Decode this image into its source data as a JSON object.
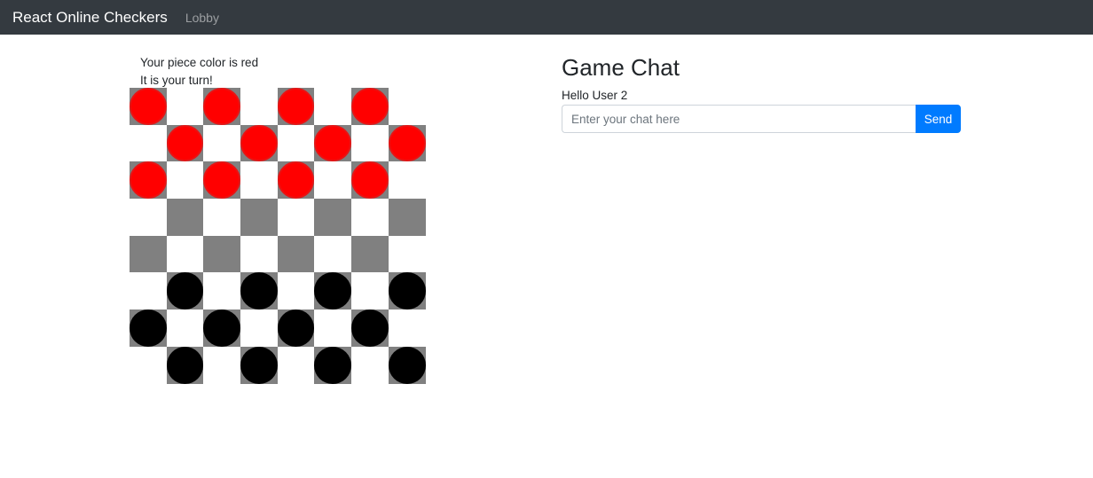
{
  "navbar": {
    "brand": "React Online Checkers",
    "links": [
      "Lobby"
    ]
  },
  "game": {
    "color_message": "Your piece color is red",
    "turn_message": "It is your turn!",
    "board": [
      [
        "r",
        ".",
        "r",
        ".",
        "r",
        ".",
        "r",
        "."
      ],
      [
        ".",
        "r",
        ".",
        "r",
        ".",
        "r",
        ".",
        "r"
      ],
      [
        "r",
        ".",
        "r",
        ".",
        "r",
        ".",
        "r",
        "."
      ],
      [
        ".",
        "_",
        ".",
        "_",
        ".",
        "_",
        ".",
        "_"
      ],
      [
        "_",
        ".",
        "_",
        ".",
        "_",
        ".",
        "_",
        "."
      ],
      [
        ".",
        "b",
        ".",
        "b",
        ".",
        "b",
        ".",
        "b"
      ],
      [
        "b",
        ".",
        "b",
        ".",
        "b",
        ".",
        "b",
        "."
      ],
      [
        ".",
        "b",
        ".",
        "b",
        ".",
        "b",
        ".",
        "b"
      ]
    ],
    "colors": {
      "dark_square": "#808080",
      "light_square": "#ffffff",
      "red_piece": "#ff0000",
      "red_piece_border": "#e81414",
      "black_piece": "#000000"
    }
  },
  "chat": {
    "title": "Game Chat",
    "greeting": "Hello User 2",
    "input_value": "",
    "input_placeholder": "Enter your chat here",
    "send_label": "Send"
  }
}
